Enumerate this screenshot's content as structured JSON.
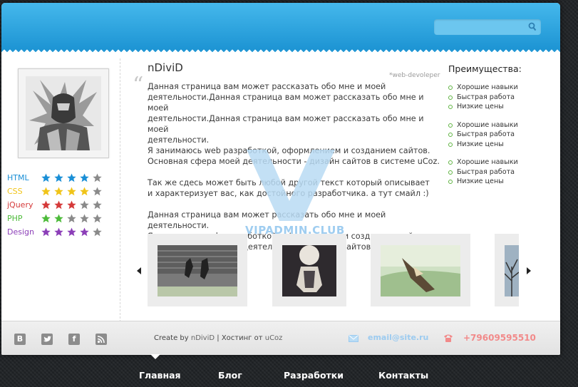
{
  "header": {
    "search": {
      "placeholder": "",
      "icon": "search-icon"
    }
  },
  "profile": {
    "name": "nDiviD",
    "subtitle": "*web-devoleper",
    "bio": [
      "Данная страница вам может рассказать обо мне и моей\nдеятельности.Данная страница вам может рассказать обо мне и моей\nдеятельности.Данная страница вам может рассказать обо мне и моей\nдеятельности.\nЯ занимаюсь web разработкой, оформлением и созданием сайтов.\nОсновная сфера моей деятельности - дизайн сайтов в системе uCoz.",
      "Так же сдесь может быть любой другой текст который описывает\nи характеризует вас, как достойного разработчика. а тут смайл :)",
      "Данная страница вам может рассказать обо мне и моей деятельности.\nЯ занимаюсь web разработкой, оформлением и созданием сайтов.\nОсновная сфера моей деятельности - дизайн сайтов в системе uCoz."
    ]
  },
  "skills": [
    {
      "name": "HTML",
      "rating": 4,
      "color": "#1a8fd6"
    },
    {
      "name": "CSS",
      "rating": 4,
      "color": "#f0c419"
    },
    {
      "name": "jQuery",
      "rating": 3,
      "color": "#d53a3a"
    },
    {
      "name": "PHP",
      "rating": 2,
      "color": "#4dbb3a"
    },
    {
      "name": "Design",
      "rating": 4,
      "color": "#8c3fb8"
    }
  ],
  "advantages": {
    "title": "Преимущества:",
    "groups": [
      [
        "Хорошие навыки",
        "Быстрая работа",
        "Низкие цены"
      ],
      [
        "Хорошие навыки",
        "Быстрая работа",
        "Низкие цены"
      ],
      [
        "Хорошие навыки",
        "Быстрая работа",
        "Низкие цены"
      ]
    ]
  },
  "watermark": "VIPADMIN.CLUB",
  "footer": {
    "social": [
      "vk-icon",
      "twitter-icon",
      "facebook-icon",
      "rss-icon"
    ],
    "credits": {
      "prefix": "Create by",
      "author": "nDiviD",
      "sep": "|",
      "hosting": "Хостинг от",
      "host": "uCoz"
    },
    "email": "email@site.ru",
    "phone": "+79609595510"
  },
  "nav": [
    {
      "label": "Главная",
      "active": true
    },
    {
      "label": "Блог"
    },
    {
      "label": "Разработки"
    },
    {
      "label": "Контакты"
    }
  ],
  "colors": {
    "header": "#2aa3e0",
    "star_empty": "#8a8a8a",
    "accent_green": "#5fb341"
  }
}
